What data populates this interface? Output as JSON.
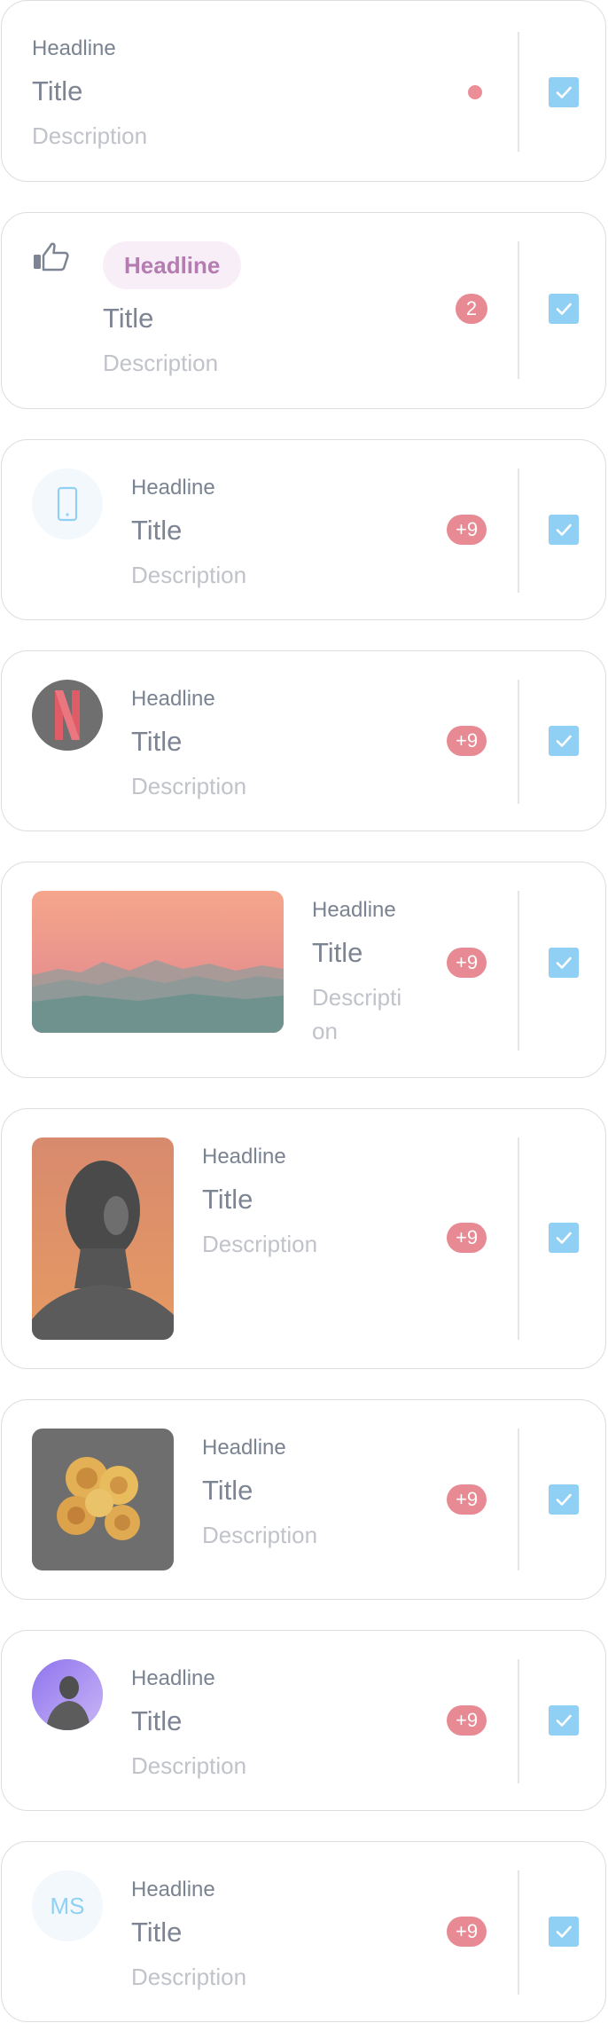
{
  "items": [
    {
      "headline": "Headline",
      "title": "Title",
      "description": "Description",
      "trailing": "dot"
    },
    {
      "headline": "Headline",
      "title": "Title",
      "description": "Description",
      "badge": "2",
      "leading_icon": "thumbs-up-icon"
    },
    {
      "headline": "Headline",
      "title": "Title",
      "description": "Description",
      "badge": "+9",
      "leading_icon": "smartphone-icon"
    },
    {
      "headline": "Headline",
      "title": "Title",
      "description": "Description",
      "badge": "+9",
      "leading_icon": "netflix-logo"
    },
    {
      "headline": "Headline",
      "title": "Title",
      "description_line1": "Descripti",
      "description_line2": "on",
      "badge": "+9",
      "leading_media": "mountain-sunset-image"
    },
    {
      "headline": "Headline",
      "title": "Title",
      "description": "Description",
      "badge": "+9",
      "leading_media": "portrait-photo"
    },
    {
      "headline": "Headline",
      "title": "Title",
      "description": "Description",
      "badge": "+9",
      "leading_media": "roses-photo"
    },
    {
      "headline": "Headline",
      "title": "Title",
      "description": "Description",
      "badge": "+9",
      "leading_icon": "avatar-photo"
    },
    {
      "headline": "Headline",
      "title": "Title",
      "description": "Description",
      "badge": "+9",
      "avatar_initials": "MS"
    }
  ],
  "colors": {
    "checkbox": "#90d0f4",
    "badge": "#e88a93",
    "pill_background": "#f8eef7",
    "pill_text": "#b47cb1",
    "initials": "#8fd0f4"
  },
  "checkbox_checked": true
}
